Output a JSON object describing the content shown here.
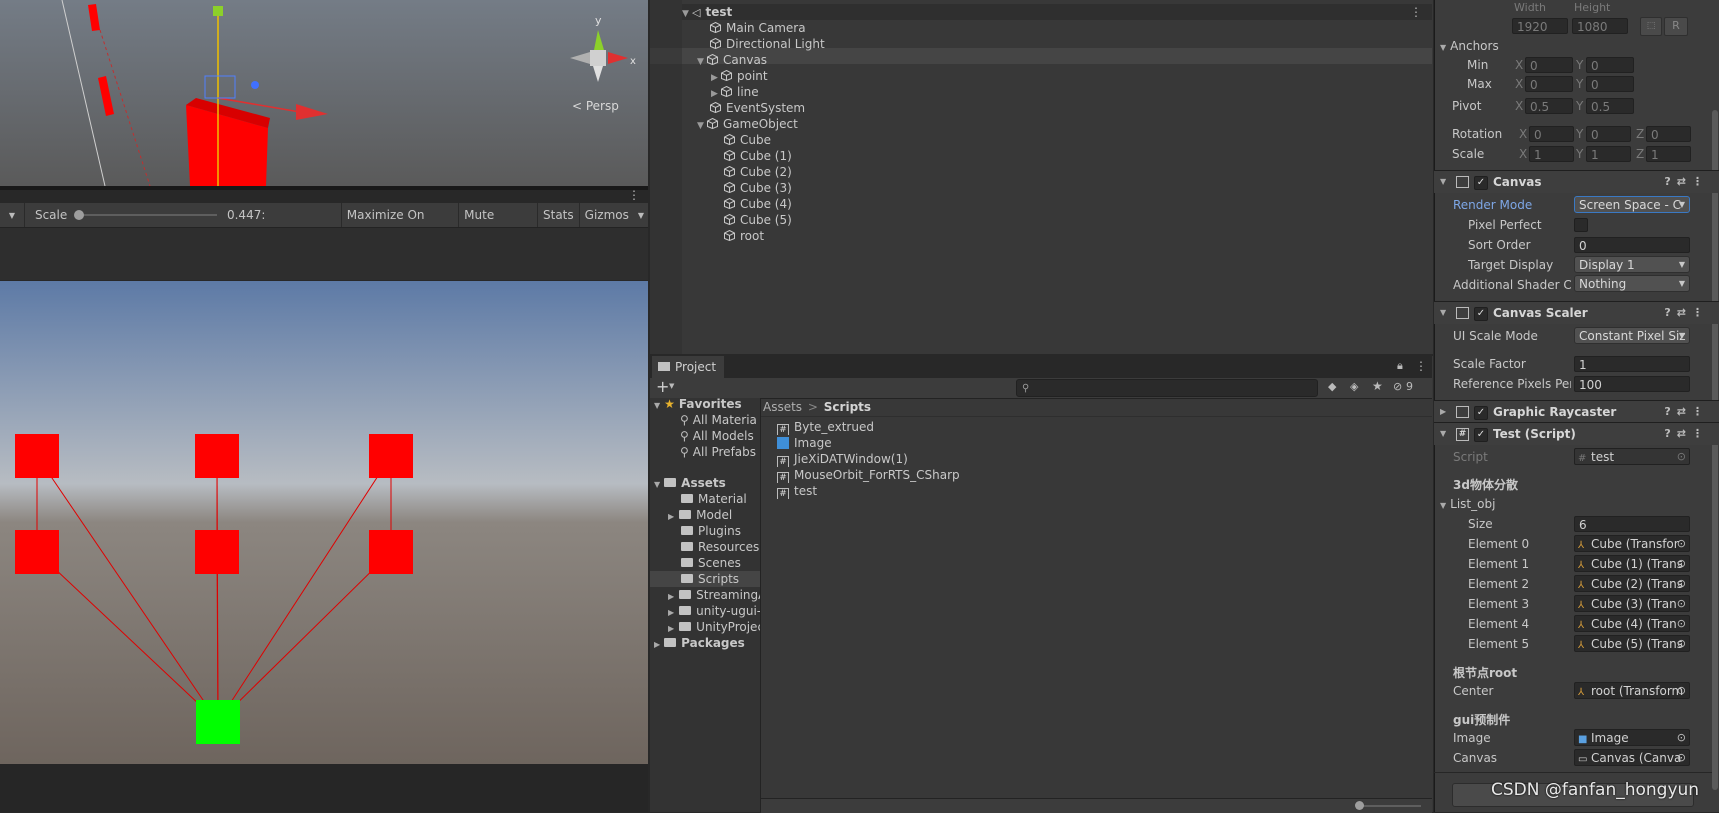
{
  "scene": {
    "persp_label": "< Persp",
    "gizmo_axis_y": "y",
    "gizmo_axis_x": "x"
  },
  "game_toolbar": {
    "scale_label": "Scale",
    "scale_value": "0.447:",
    "scale_slider_fraction": 0.0,
    "maximize_label": "Maximize On Play",
    "mute_label": "Mute Audio",
    "stats_label": "Stats",
    "gizmos_label": "Gizmos"
  },
  "game_view": {
    "node_color": "#ff0000",
    "root_color": "#00ff00",
    "line_color": "#e00000"
  },
  "hierarchy": {
    "scene_name": "test",
    "items": [
      {
        "label": "Main Camera"
      },
      {
        "label": "Directional Light"
      },
      {
        "label": "Canvas"
      },
      {
        "label": "point"
      },
      {
        "label": "line"
      },
      {
        "label": "EventSystem"
      },
      {
        "label": "GameObject"
      },
      {
        "label": "Cube"
      },
      {
        "label": "Cube (1)"
      },
      {
        "label": "Cube (2)"
      },
      {
        "label": "Cube (3)"
      },
      {
        "label": "Cube (4)"
      },
      {
        "label": "Cube (5)"
      },
      {
        "label": "root"
      }
    ]
  },
  "project": {
    "tab_label": "Project",
    "hidden_count": "9",
    "tree": {
      "favorites": "Favorites",
      "fav_items": [
        "All Materia",
        "All Models",
        "All Prefabs"
      ],
      "assets": "Assets",
      "asset_folders": [
        "Material",
        "Model",
        "Plugins",
        "Resources",
        "Scenes",
        "Scripts",
        "StreamingA",
        "unity-ugui-",
        "UnityProjec"
      ],
      "packages": "Packages"
    },
    "breadcrumb_root": "Assets",
    "breadcrumb_sep": ">",
    "breadcrumb_current": "Scripts",
    "files": [
      {
        "label": "Byte_extrued",
        "kind": "script"
      },
      {
        "label": "Image",
        "kind": "prefab"
      },
      {
        "label": "JieXiDATWindow(1)",
        "kind": "script"
      },
      {
        "label": "MouseOrbit_ForRTS_CSharp",
        "kind": "script"
      },
      {
        "label": "test",
        "kind": "script"
      }
    ]
  },
  "inspector": {
    "width_label": "Width",
    "height_label": "Height",
    "width_value": "1920",
    "height_value": "1080",
    "r_button": "R",
    "anchors_label": "Anchors",
    "min_label": "Min",
    "max_label": "Max",
    "pivot_label": "Pivot",
    "rotation_label": "Rotation",
    "scale_label": "Scale",
    "x": "X",
    "y": "Y",
    "z": "Z",
    "anchor_min_x": "0",
    "anchor_min_y": "0",
    "anchor_max_x": "0",
    "anchor_max_y": "0",
    "pivot_x": "0.5",
    "pivot_y": "0.5",
    "rot_x": "0",
    "rot_y": "0",
    "rot_z": "0",
    "scale_x": "1",
    "scale_y": "1",
    "scale_z": "1",
    "canvas": {
      "title": "Canvas",
      "render_mode_label": "Render Mode",
      "render_mode_value": "Screen Space - C",
      "pixel_perfect_label": "Pixel Perfect",
      "sort_order_label": "Sort Order",
      "sort_order_value": "0",
      "target_display_label": "Target Display",
      "target_display_value": "Display 1",
      "shader_label": "Additional Shader Ch",
      "shader_value": "Nothing"
    },
    "scaler": {
      "title": "Canvas Scaler",
      "ui_scale_label": "UI Scale Mode",
      "ui_scale_value": "Constant Pixel Siz",
      "scale_factor_label": "Scale Factor",
      "scale_factor_value": "1",
      "ref_ppu_label": "Reference Pixels Per",
      "ref_ppu_value": "100"
    },
    "raycaster": {
      "title": "Graphic Raycaster"
    },
    "test_script": {
      "title": "Test (Script)",
      "script_label": "Script",
      "script_value": "test",
      "header_3d": "3d物体分散",
      "list_label": "List_obj",
      "size_label": "Size",
      "size_value": "6",
      "elements": [
        {
          "label": "Element 0",
          "value": "Cube (Transfor"
        },
        {
          "label": "Element 1",
          "value": "Cube (1) (Trans"
        },
        {
          "label": "Element 2",
          "value": "Cube (2) (Trans"
        },
        {
          "label": "Element 3",
          "value": "Cube (3) (Tran"
        },
        {
          "label": "Element 4",
          "value": "Cube (4) (Tran"
        },
        {
          "label": "Element 5",
          "value": "Cube (5) (Trans"
        }
      ],
      "header_root": "根节点root",
      "center_label": "Center",
      "center_value": "root (Transform",
      "header_gui": "gui预制件",
      "image_label": "Image",
      "image_value": "Image",
      "canvas_label": "Canvas",
      "canvas_value": "Canvas (Canva"
    }
  },
  "watermark": "CSDN @fanfan_hongyun"
}
